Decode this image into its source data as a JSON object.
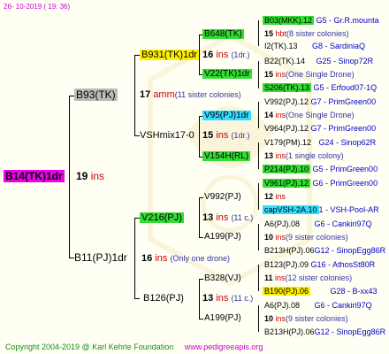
{
  "header": {
    "date": "26- 10-2019 ( 19: 36)"
  },
  "footer": {
    "copyright": "Copyright 2004-2019 @ Karl Kehrle Foundation",
    "site": "www.pedigreeapis.org"
  },
  "colors": {
    "green": "#33dd33",
    "yellow": "#ffee00",
    "gray": "#bbbbbb",
    "cyan": "#33ddff",
    "magenta": "#ee00ee",
    "red": "#cc0000",
    "blue": "#0000cc"
  },
  "root": {
    "name": "B14(TK)1dr",
    "inbreeding": "19",
    "ins_label": "ins"
  },
  "gen1": [
    {
      "name": "B93(TK)",
      "inbreeding": "17",
      "ins_label": "amm",
      "note": "(11 sister colonies)"
    },
    {
      "name": "B11(PJ)1dr",
      "inbreeding": "16",
      "ins_label": "ins",
      "note": "(Only one drone)"
    }
  ],
  "gen2": [
    {
      "name": "B931(TK)1dr",
      "inbreeding": "16",
      "ins_label": "ins",
      "note": "(1dr.)"
    },
    {
      "name": "VSHmix17-0",
      "inbreeding": "15",
      "ins_label": "ins",
      "note": "(1dr.)"
    },
    {
      "name": "V216(PJ)",
      "inbreeding": "13",
      "ins_label": "ins",
      "note": "(11 c.)"
    },
    {
      "name": "B126(PJ)",
      "inbreeding": "13",
      "ins_label": "ins",
      "note": "(11 c.)"
    }
  ],
  "gen3": [
    {
      "name": "B648(TK)"
    },
    {
      "name": "V22(TK)1dr"
    },
    {
      "name": "V95(PJ)1dr"
    },
    {
      "name": "V154H(RL)"
    },
    {
      "name": "V992(PJ)"
    },
    {
      "name": "A199(PJ)"
    },
    {
      "name": "B328(VJ)"
    },
    {
      "name": "A199(PJ)"
    }
  ],
  "gen4": [
    {
      "name": "B03(MKK).12",
      "info": "G5 - Gr.R.mounta"
    },
    {
      "name": "15",
      "ins_label": "hbt",
      "note": "(8 sister colonies)"
    },
    {
      "name": "I2(TK).13",
      "info": "G8 - SardiniaQ"
    },
    {
      "name": "B22(TK).14",
      "info": "G25 - Sinop72R"
    },
    {
      "name": "15",
      "ins_label": "ins",
      "note": "(One Single Drone)"
    },
    {
      "name": "S206(TK).13",
      "info": "G5 - Erfoud07-1Q"
    },
    {
      "name": "V992(PJ).12",
      "info": "G7 - PrimGreen00"
    },
    {
      "name": "14",
      "ins_label": "ins",
      "note": "(One Single Drone)"
    },
    {
      "name": "V964(PJ).12",
      "info": "G7 - PrimGreen00"
    },
    {
      "name": "V179(PM).12",
      "info": "G24 - Sinop62R"
    },
    {
      "name": "13",
      "ins_label": "ins",
      "note": "(1 single colony)"
    },
    {
      "name": "P214(PJ).10",
      "info": "G5 - PrimGreen00"
    },
    {
      "name": "V961(PJ).12",
      "info": "G6 - PrimGreen00"
    },
    {
      "name": "12",
      "ins_label": "ins",
      "note": ""
    },
    {
      "name": "capVSH-2A.10",
      "info": "1 - VSH-Pool-AR"
    },
    {
      "name": "A6(PJ).08",
      "info": "G6 - Cankiri97Q"
    },
    {
      "name": "10",
      "ins_label": "ins",
      "note": "(9 sister colonies)"
    },
    {
      "name": "B213H(PJ).06",
      "info": "G12 - SinopEgg86R"
    },
    {
      "name": "B123(PJ).09",
      "info": "G16 - AthosSt80R"
    },
    {
      "name": "11",
      "ins_label": "ins",
      "note": "(12 sister colonies)"
    },
    {
      "name": "B190(PJ).06",
      "info": "G28 - B-xx43"
    },
    {
      "name": "A6(PJ).08",
      "info": "G6 - Cankiri97Q"
    },
    {
      "name": "10",
      "ins_label": "ins",
      "note": "(9 sister colonies)"
    },
    {
      "name": "B213H(PJ).06",
      "info": "G12 - SinopEgg86R"
    }
  ]
}
